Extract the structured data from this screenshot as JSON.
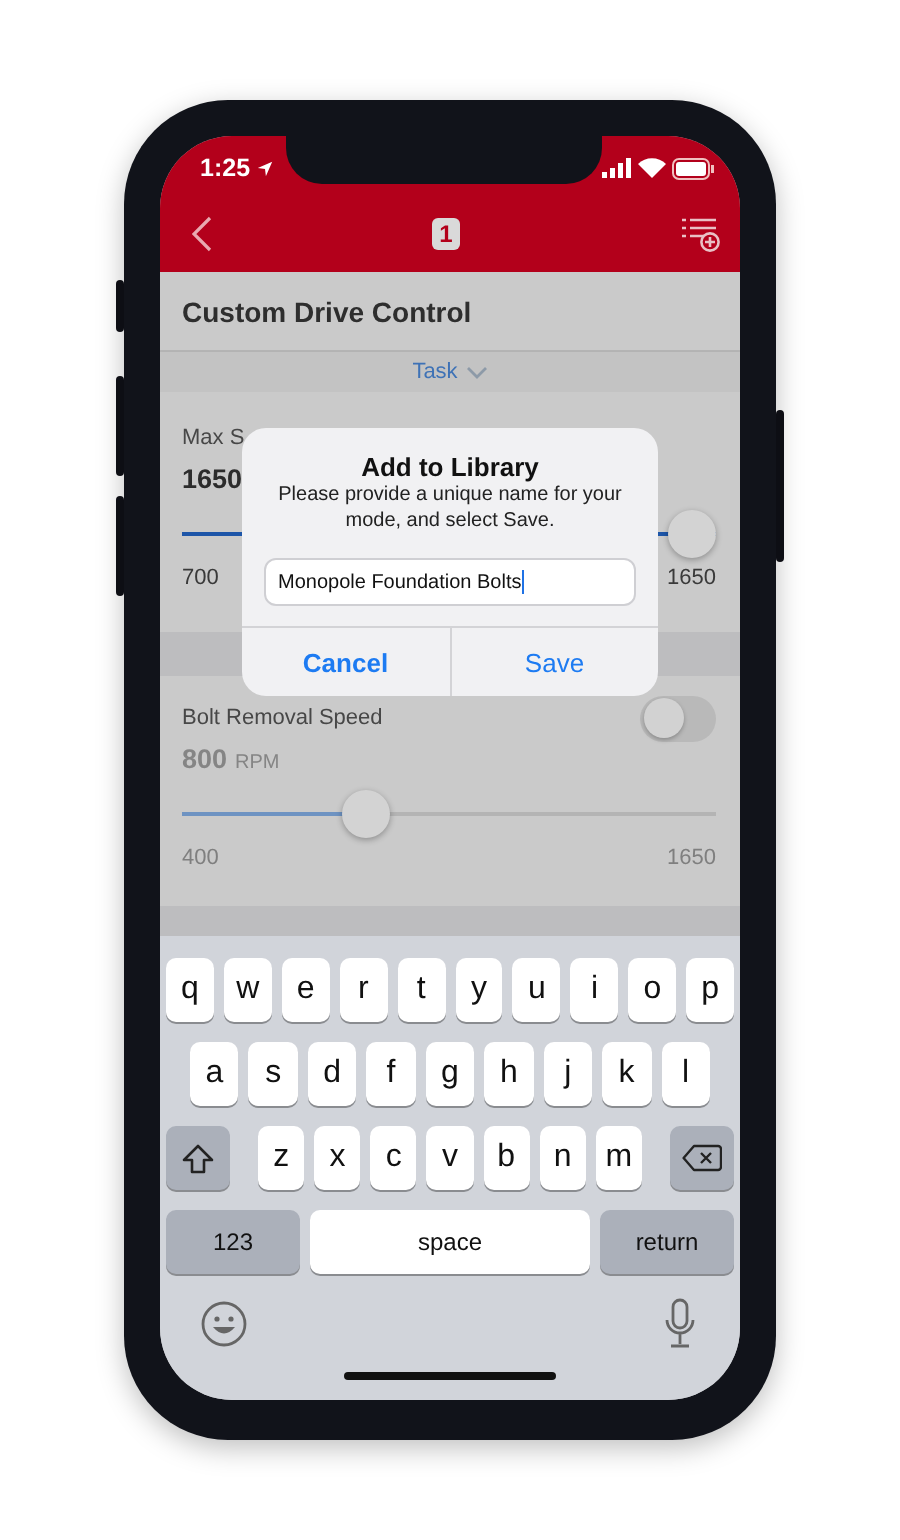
{
  "status_bar": {
    "time": "1:25"
  },
  "nav_bar": {
    "badge": "1"
  },
  "header": {
    "title": "Custom Drive Control"
  },
  "task_selector": {
    "label": "Task",
    "expanded": false
  },
  "sections": [
    {
      "label": "Max S",
      "value": "1650",
      "disabled": false,
      "level": 1,
      "min": "700",
      "max": "1650"
    },
    {
      "label": "Bolt Removal Speed",
      "value": "800",
      "unit": "RPM",
      "toggle_on": false,
      "disabled": true,
      "level": 0.33,
      "min": "400",
      "max": "1650"
    }
  ],
  "dialog": {
    "title": "Add to Library",
    "message": "Please provide a unique name for your mode, and select Save.",
    "input_value": "Monopole Foundation Bolts",
    "buttons": [
      "Cancel",
      "Save"
    ]
  },
  "keyboard": {
    "rows": [
      [
        "q",
        "w",
        "e",
        "r",
        "t",
        "y",
        "u",
        "i",
        "o",
        "p"
      ],
      [
        "a",
        "s",
        "d",
        "f",
        "g",
        "h",
        "j",
        "k",
        "l"
      ],
      [
        "z",
        "x",
        "c",
        "v",
        "b",
        "n",
        "m"
      ]
    ],
    "numbers_key": "123",
    "space_key": "space",
    "return_key": "return"
  }
}
